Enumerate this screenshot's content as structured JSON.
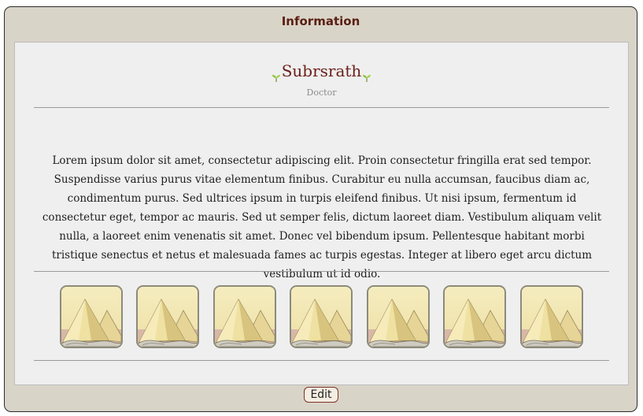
{
  "window": {
    "title": "Information"
  },
  "profile": {
    "name": "Subrsrath",
    "role": "Doctor",
    "bio": "Lorem ipsum dolor sit amet, consectetur adipiscing elit. Proin consectetur fringilla erat sed tempor. Suspendisse varius purus vitae elementum finibus. Curabitur eu nulla accumsan, faucibus diam ac, condimentum purus. Sed ultrices ipsum in turpis eleifend finibus. Ut nisi ipsum, fermentum id consectetur eget, tempor ac mauris. Sed ut semper felis, dictum laoreet diam. Vestibulum aliquam velit nulla, a laoreet enim venenatis sit amet. Donec vel bibendum ipsum. Pellentesque habitant morbi tristique senectus et netus et malesuada fames ac turpis egestas. Integer at libero eget arcu dictum vestibulum ut id odio."
  },
  "icons": {
    "name_decoration": "leaf-icon",
    "tiles": [
      "sand-pile-icon",
      "sand-pile-icon",
      "sand-pile-icon",
      "sand-pile-icon",
      "sand-pile-icon",
      "sand-pile-icon",
      "sand-pile-icon"
    ]
  },
  "actions": {
    "edit_label": "Edit"
  },
  "colors": {
    "title": "#5a1f12",
    "name": "#6b1f1a",
    "leaf": "#8fbf3a",
    "window_bg": "#d9d4c8",
    "panel_bg": "#efefef"
  }
}
